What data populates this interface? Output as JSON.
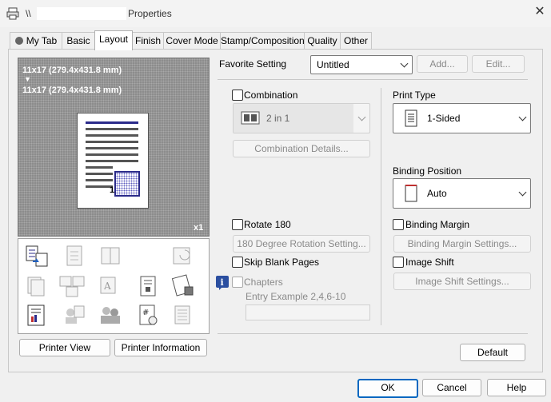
{
  "window": {
    "title": "Properties",
    "path_prefix": "\\\\"
  },
  "tabs": [
    "My Tab",
    "Basic",
    "Layout",
    "Finish",
    "Cover Mode",
    "Stamp/Composition",
    "Quality",
    "Other"
  ],
  "preview": {
    "line1": "11x17 (279.4x431.8 mm)",
    "arrow": "▼",
    "line2": "11x17 (279.4x431.8 mm)",
    "page_number": "1",
    "copies": "x1"
  },
  "left_buttons": {
    "printer_view": "Printer View",
    "printer_information": "Printer Information"
  },
  "favorite": {
    "label": "Favorite Setting",
    "value": "Untitled",
    "add": "Add...",
    "edit": "Edit..."
  },
  "combination": {
    "label": "Combination",
    "value": "2 in 1",
    "details": "Combination Details..."
  },
  "print_type": {
    "label": "Print Type",
    "value": "1-Sided"
  },
  "binding_position": {
    "label": "Binding Position",
    "value": "Auto"
  },
  "rotate": {
    "label": "Rotate 180",
    "settings": "180 Degree Rotation Setting..."
  },
  "binding_margin": {
    "label": "Binding Margin",
    "settings": "Binding Margin Settings..."
  },
  "skip_blank": {
    "label": "Skip Blank Pages"
  },
  "image_shift": {
    "label": "Image Shift",
    "settings": "Image Shift Settings..."
  },
  "chapters": {
    "label": "Chapters",
    "hint": "Entry Example 2,4,6-10",
    "value": ""
  },
  "default_button": "Default",
  "dialog_buttons": {
    "ok": "OK",
    "cancel": "Cancel",
    "help": "Help"
  }
}
